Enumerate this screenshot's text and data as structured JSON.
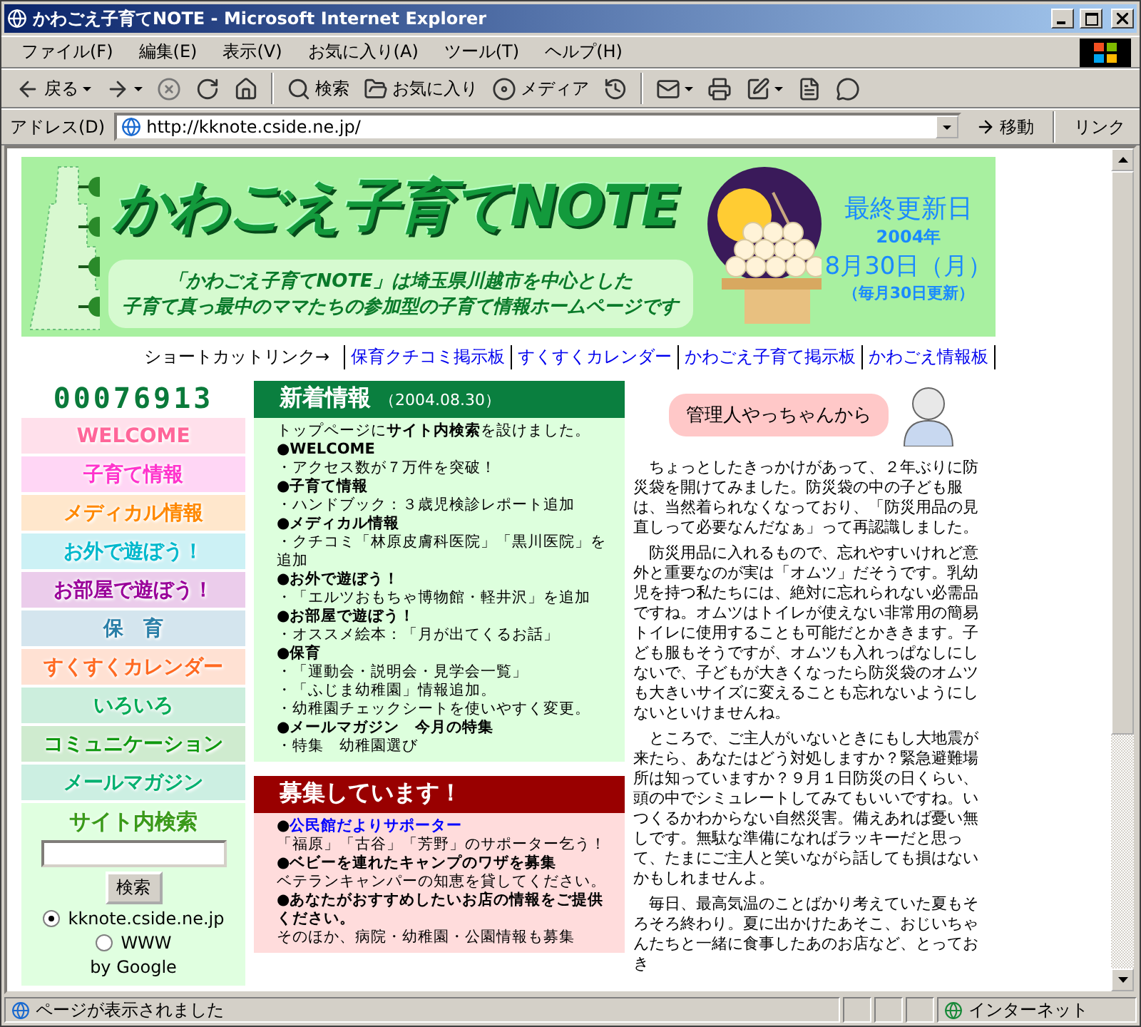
{
  "window": {
    "title": "かわごえ子育てNOTE - Microsoft Internet Explorer"
  },
  "menu": [
    "ファイル(F)",
    "編集(E)",
    "表示(V)",
    "お気に入り(A)",
    "ツール(T)",
    "ヘルプ(H)"
  ],
  "toolbar": [
    [
      {
        "kind": "back",
        "label": "戻る",
        "dropdown": true
      },
      {
        "kind": "forward",
        "dropdown": true
      },
      {
        "kind": "stop",
        "dropdown": false
      },
      {
        "kind": "refresh",
        "dropdown": false
      },
      {
        "kind": "home",
        "dropdown": false
      }
    ],
    [
      {
        "kind": "search",
        "label": "検索",
        "dropdown": false
      },
      {
        "kind": "favorites",
        "label": "お気に入り",
        "dropdown": false
      },
      {
        "kind": "media",
        "label": "メディア",
        "dropdown": false
      },
      {
        "kind": "history",
        "dropdown": false
      }
    ],
    [
      {
        "kind": "mail",
        "dropdown": true
      },
      {
        "kind": "print",
        "dropdown": false
      },
      {
        "kind": "edit",
        "dropdown": true
      },
      {
        "kind": "discuss",
        "dropdown": false
      },
      {
        "kind": "messenger",
        "dropdown": false
      }
    ]
  ],
  "address": {
    "label": "アドレス(D)",
    "url": "http://kknote.cside.ne.jp/",
    "go": "移動",
    "links": "リンク"
  },
  "banner": {
    "title": "かわごえ子育てNOTE",
    "tagline": [
      "「かわごえ子育てNOTE」は埼玉県川越市を中心とした",
      "子育て真っ最中のママたちの参加型の子育て情報ホームページです"
    ],
    "updated_label": "最終更新日",
    "year": "2004年",
    "date": "8月30日（月）",
    "note": "（毎月30日更新）"
  },
  "shortcuts": {
    "label": "ショートカットリンク→",
    "links": [
      "保育クチコミ掲示板",
      "すくすくカレンダー",
      "かわごえ子育て掲示板",
      "かわごえ情報板"
    ]
  },
  "counter": "00076913",
  "nav": [
    {
      "label": "WELCOME",
      "color": "#ff6699"
    },
    {
      "label": "子育て情報",
      "color": "#ff33cc"
    },
    {
      "label": "メディカル情報",
      "color": "#ff8800"
    },
    {
      "label": "お外で遊ぼう！",
      "color": "#00b8cc"
    },
    {
      "label": "お部屋で遊ぼう！",
      "color": "#990099"
    },
    {
      "label": "保　育",
      "color": "#2a7fa8"
    },
    {
      "label": "すくすくカレンダー",
      "color": "#ff6a22"
    },
    {
      "label": "いろいろ",
      "color": "#00aa55"
    },
    {
      "label": "コミュニケーション",
      "color": "#119911"
    },
    {
      "label": "メールマガジン",
      "color": "#00b070"
    }
  ],
  "site_search": {
    "title": "サイト内検索",
    "button": "検索",
    "options": [
      {
        "label": "kknote.cside.ne.jp",
        "selected": true
      },
      {
        "label": "WWW",
        "selected": false
      }
    ],
    "credit": "by Google"
  },
  "news": {
    "title": "新着情報",
    "date": "（2004.08.30）",
    "lines": [
      {
        "kind": "text",
        "text": "トップページに**サイト内検索**を設けました。"
      },
      {
        "kind": "heading",
        "text": "●WELCOME"
      },
      {
        "kind": "text",
        "text": "・アクセス数が７万件を突破！"
      },
      {
        "kind": "heading",
        "text": "●子育て情報"
      },
      {
        "kind": "text",
        "text": "・ハンドブック：３歳児検診レポート追加"
      },
      {
        "kind": "heading",
        "text": "●メディカル情報"
      },
      {
        "kind": "text",
        "text": "・クチコミ「林原皮膚科医院」「黒川医院」を追加"
      },
      {
        "kind": "heading",
        "text": "●お外で遊ぼう！"
      },
      {
        "kind": "text",
        "text": "・「エルツおもちゃ博物館・軽井沢」を追加"
      },
      {
        "kind": "heading",
        "text": "●お部屋で遊ぼう！"
      },
      {
        "kind": "text",
        "text": "・オススメ絵本：「月が出てくるお話」"
      },
      {
        "kind": "heading",
        "text": "●保育"
      },
      {
        "kind": "text",
        "text": "・「運動会・説明会・見学会一覧」"
      },
      {
        "kind": "text",
        "text": "・「ふじま幼稚園」情報追加。"
      },
      {
        "kind": "text",
        "text": "・幼稚園チェックシートを使いやすく変更。"
      },
      {
        "kind": "heading",
        "text": "●メールマガジン　今月の特集"
      },
      {
        "kind": "text",
        "text": "・特集　幼稚園選び"
      }
    ]
  },
  "recruit": {
    "title": "募集しています！",
    "lines": [
      {
        "kind": "link",
        "bullet": "●",
        "text": "公民館だよりサポーター"
      },
      {
        "kind": "text",
        "text": "「福原」「古谷」「芳野」のサポーター乞う！"
      },
      {
        "kind": "heading",
        "text": "●ベビーを連れたキャンプのワザを募集"
      },
      {
        "kind": "text",
        "text": "ベテランキャンパーの知恵を貸してください。"
      },
      {
        "kind": "heading",
        "text": "●あなたがおすすめしたいお店の情報をご提供ください。"
      },
      {
        "kind": "text",
        "text": "そのほか、病院・幼稚園・公園情報も募集"
      }
    ]
  },
  "admin": {
    "title": "管理人やっちゃんから",
    "paragraphs": [
      "ちょっとしたきっかけがあって、２年ぶりに防災袋を開けてみました。防災袋の中の子ども服は、当然着られなくなっており、「防災用品の見直しって必要なんだなぁ」って再認識しました。",
      "防災用品に入れるもので、忘れやすいけれど意外と重要なのが実は「オムツ」だそうです。乳幼児を持つ私たちには、絶対に忘れられない必需品ですね。オムツはトイレが使えない非常用の簡易トイレに使用することも可能だとかききます。子ども服もそうですが、オムツも入れっぱなしにしないで、子どもが大きくなったら防災袋のオムツも大きいサイズに変えることも忘れないようにしないといけませんね。",
      "ところで、ご主人がいないときにもし大地震が来たら、あなたはどう対処しますか？緊急避難場所は知っていますか？９月１日防災の日くらい、頭の中でシミュレートしてみてもいいですね。いつくるかわからない自然災害。備えあれば憂い無しです。無駄な準備になればラッキーだと思って、たまにご主人と笑いながら話しても損はないかもしれませんよ。",
      "毎日、最高気温のことばかり考えていた夏もそろそろ終わり。夏に出かけたあそこ、おじいちゃんたちと一緒に食事したあのお店など、とっておき"
    ]
  },
  "status": {
    "text": "ページが表示されました",
    "zone": "インターネット"
  }
}
